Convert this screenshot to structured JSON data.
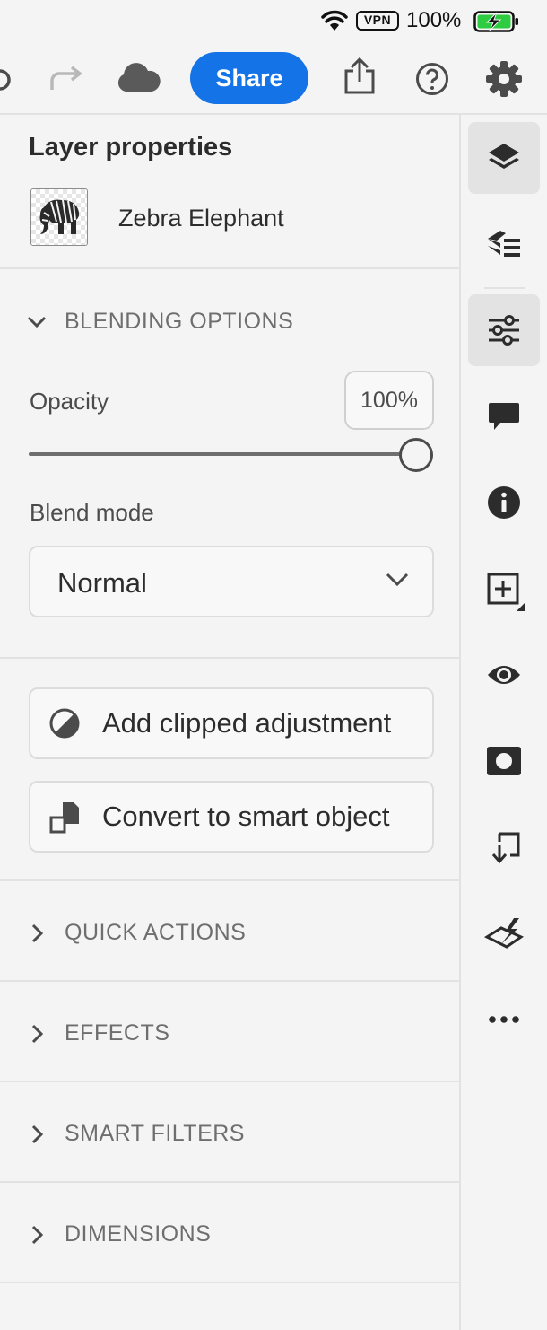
{
  "status_bar": {
    "vpn": "VPN",
    "battery_percent": "100%"
  },
  "toolbar": {
    "share_label": "Share",
    "icons": [
      "redo-icon",
      "undo-icon",
      "cloud-icon",
      "export-icon",
      "help-icon",
      "settings-icon"
    ]
  },
  "panel": {
    "title": "Layer properties",
    "layer_name": "Zebra Elephant",
    "blending": {
      "header": "BLENDING OPTIONS",
      "expanded": true,
      "opacity_label": "Opacity",
      "opacity_value": "100%",
      "opacity_fraction": 1.0,
      "blend_mode_label": "Blend mode",
      "blend_mode_value": "Normal"
    },
    "actions": {
      "clipped_adjustment": "Add clipped adjustment",
      "smart_object": "Convert to smart object"
    },
    "sections": [
      {
        "label": "QUICK ACTIONS",
        "expanded": false
      },
      {
        "label": "EFFECTS",
        "expanded": false
      },
      {
        "label": "SMART FILTERS",
        "expanded": false
      },
      {
        "label": "DIMENSIONS",
        "expanded": false
      }
    ]
  },
  "rail": {
    "items": [
      "layers-icon",
      "layer-stack-icon",
      "adjustments-icon",
      "comment-icon",
      "info-icon",
      "add-layer-icon",
      "visibility-icon",
      "mask-icon",
      "move-down-icon",
      "clear-icon",
      "more-icon"
    ],
    "active": [
      "layers-icon",
      "adjustments-icon"
    ]
  },
  "colors": {
    "accent": "#1473e6",
    "background": "#f4f4f4",
    "battery": "#2ecc40"
  }
}
